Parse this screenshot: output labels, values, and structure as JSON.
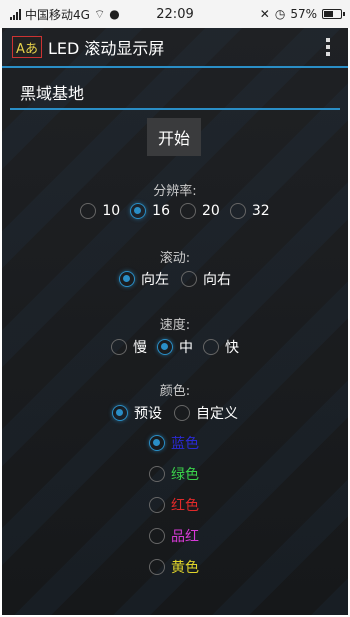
{
  "status_bar": {
    "carrier": "中国移动4G",
    "time": "22:09",
    "battery": "57%",
    "battery_level": 0.57
  },
  "app": {
    "icon_text": "Aあ",
    "title": "LED 滚动显示屏"
  },
  "input": {
    "value": "黑域基地"
  },
  "start_button": "开始",
  "resolution": {
    "label": "分辨率:",
    "options": [
      "10",
      "16",
      "20",
      "32"
    ],
    "selected": "16"
  },
  "scroll": {
    "label": "滚动:",
    "options": [
      "向左",
      "向右"
    ],
    "selected": "向左"
  },
  "speed": {
    "label": "速度:",
    "options": [
      "慢",
      "中",
      "快"
    ],
    "selected": "中"
  },
  "color": {
    "label": "颜色:",
    "modes": [
      "预设",
      "自定义"
    ],
    "selected_mode": "预设",
    "presets": [
      {
        "label": "蓝色",
        "color": "#2a2ad4",
        "checked": true
      },
      {
        "label": "绿色",
        "color": "#3ad14a",
        "checked": false
      },
      {
        "label": "红色",
        "color": "#e02a2a",
        "checked": false
      },
      {
        "label": "品红",
        "color": "#d63ad6",
        "checked": false
      },
      {
        "label": "黄色",
        "color": "#e0d42a",
        "checked": false
      }
    ]
  }
}
